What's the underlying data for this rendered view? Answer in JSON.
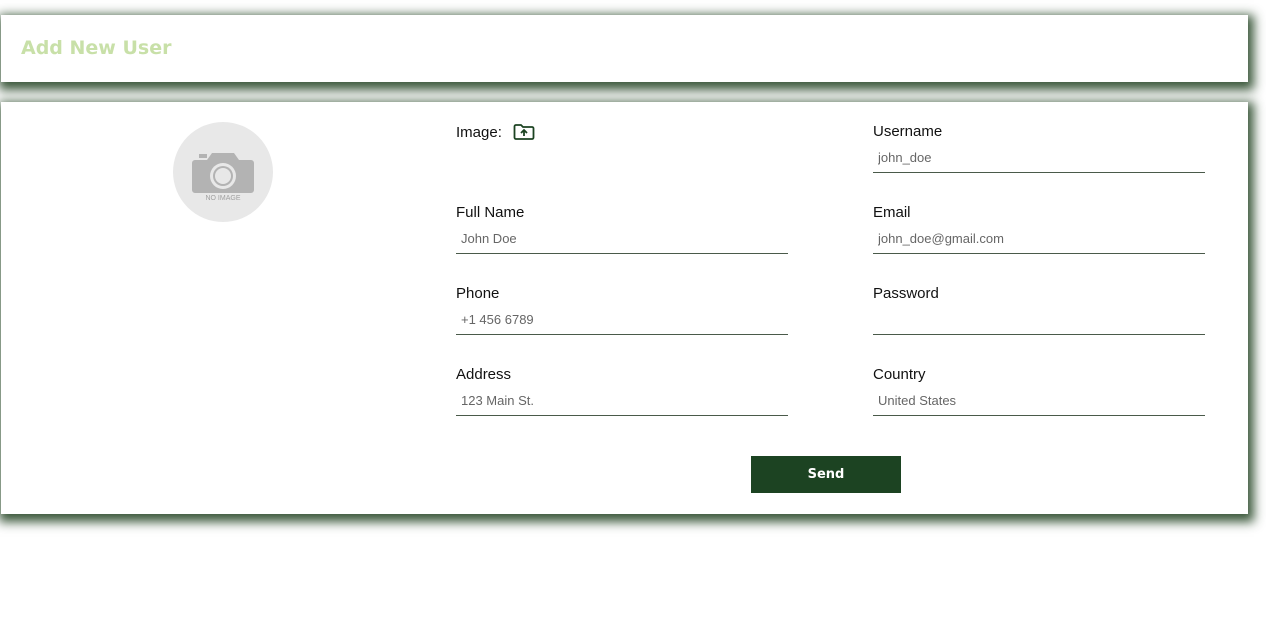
{
  "header": {
    "title": "Add New User"
  },
  "avatar": {
    "icon": "camera-icon",
    "caption": "NO IMAGE"
  },
  "form": {
    "image_label": "Image:",
    "upload_icon": "folder-upload-icon",
    "fields": {
      "username": {
        "label": "Username",
        "placeholder": "john_doe"
      },
      "full_name": {
        "label": "Full Name",
        "placeholder": "John Doe"
      },
      "email": {
        "label": "Email",
        "placeholder": "john_doe@gmail.com"
      },
      "phone": {
        "label": "Phone",
        "placeholder": "+1 456 6789"
      },
      "password": {
        "label": "Password",
        "placeholder": ""
      },
      "address": {
        "label": "Address",
        "placeholder": "123 Main St."
      },
      "country": {
        "label": "Country",
        "placeholder": "United States"
      }
    },
    "submit_label": "Send"
  },
  "colors": {
    "accent": "#1c4322",
    "title": "#c8e0a8",
    "shadow": "#1a3c1a"
  }
}
